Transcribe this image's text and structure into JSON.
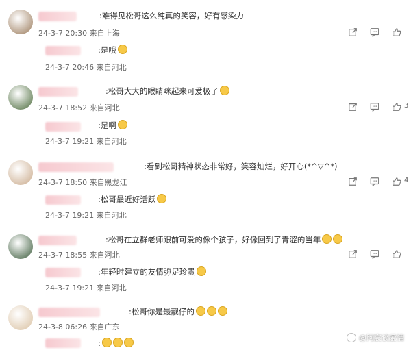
{
  "comments": [
    {
      "avatar_color": "#9a7a5a",
      "badge": "",
      "text": "难得见松哥这么纯真的笑容，好有感染力",
      "meta": "24-3-7 20:30 来自上海",
      "reply": {
        "badge": "",
        "text": "是哦",
        "meta": "24-3-7 20:46 来自河北"
      }
    },
    {
      "avatar_color": "#4a6a3a",
      "badge": "",
      "text": "松哥大大的眼睛眯起来可爱极了",
      "meta": "24-3-7 18:52 来自河北",
      "count": "3",
      "reply": {
        "badge": "",
        "text": "是啊",
        "meta": "24-3-7 19:21 来自河北"
      }
    },
    {
      "avatar_color": "#c9a98a",
      "badge": "",
      "text": "看到松哥精神状态非常好，笑容灿烂，好开心(*^▽^*)",
      "meta": "24-3-7 18:50 来自黑龙江",
      "count": "4",
      "reply": {
        "badge": "",
        "text": "松哥最近好活跃",
        "meta": "24-3-7 19:21 来自河北"
      }
    },
    {
      "avatar_color": "#3a5a3a",
      "badge": "",
      "text": "松哥在立群老师跟前可爱的像个孩子，好像回到了青涩的当年",
      "meta": "24-3-7 18:55 来自河北",
      "reply": {
        "badge": "",
        "text": "年轻时建立的友情弥足珍贵",
        "meta": "24-3-7 19:21 来自河北"
      }
    },
    {
      "avatar_color": "#d9c0a0",
      "badge": "",
      "text": "松哥你是最靓仔的",
      "meta": "24-3-8 06:26 来自广东",
      "reply": {
        "badge": "",
        "text": "",
        "meta": ""
      }
    }
  ],
  "watermark": "@阿宸谈爱情",
  "icons": {
    "share": "share-icon",
    "comment": "comment-icon",
    "like": "like-icon"
  }
}
